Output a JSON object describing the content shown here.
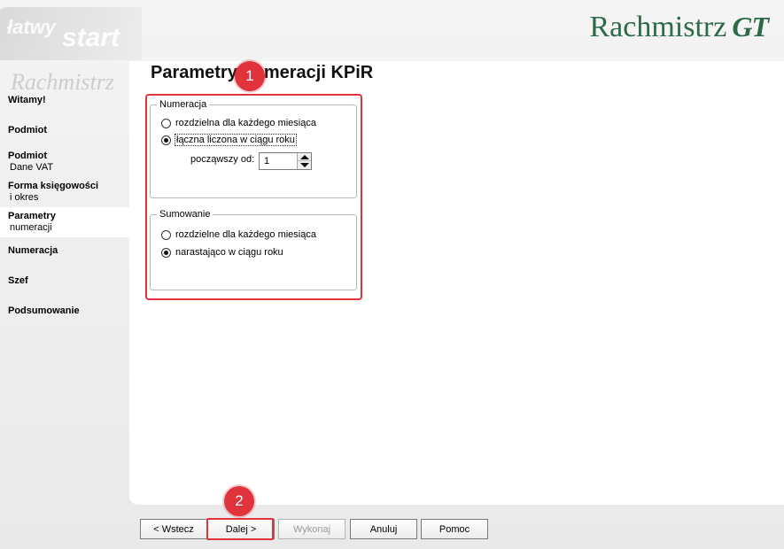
{
  "logo": {
    "brand": "Rachmistrz",
    "suffix": "GT"
  },
  "watermark": {
    "line1": "łatwy",
    "line2": "start",
    "line3": "Rachmistrz"
  },
  "sidebar": {
    "items": [
      {
        "title": "Witamy!",
        "sub": ""
      },
      {
        "title": "Podmiot",
        "sub": ""
      },
      {
        "title": "Podmiot",
        "sub": "Dane VAT"
      },
      {
        "title": "Forma księgowości",
        "sub": "i okres"
      },
      {
        "title": "Parametry",
        "sub": "numeracji",
        "active": true
      },
      {
        "title": "Numeracja",
        "sub": ""
      },
      {
        "title": "Szef",
        "sub": ""
      },
      {
        "title": "Podsumowanie",
        "sub": ""
      }
    ]
  },
  "page": {
    "title": "Parametry numeracji KPiR"
  },
  "numeracja": {
    "legend": "Numeracja",
    "option1": "rozdzielna dla każdego miesiąca",
    "option2": "łączna liczona w ciągu roku",
    "selected": "option2",
    "start_label": "począwszy od:",
    "start_value": "1"
  },
  "sumowanie": {
    "legend": "Sumowanie",
    "option1": "rozdzielne dla każdego miesiąca",
    "option2": "narastająco w ciągu roku",
    "selected": "option2"
  },
  "badges": {
    "one": "1",
    "two": "2"
  },
  "buttons": {
    "back": "< Wstecz",
    "next": "Dalej >",
    "execute": "Wykonaj",
    "cancel": "Anuluj",
    "help": "Pomoc"
  },
  "colors": {
    "accent": "#e0333c",
    "brand": "#2d6a4a"
  }
}
